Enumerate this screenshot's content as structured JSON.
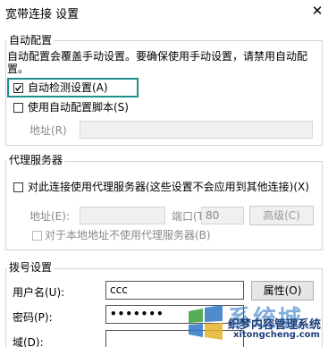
{
  "window": {
    "title": "宽带连接 设置",
    "close_glyph": "✕"
  },
  "auto_config": {
    "group_label": "自动配置",
    "desc_line1": "自动配置会覆盖手动设置。要确保使用手动设置，请禁用自动配",
    "desc_line2": "置。",
    "auto_detect_label": "自动检测设置(A)",
    "auto_detect_checked": true,
    "script_label": "使用自动配置脚本(S)",
    "script_checked": false,
    "address_label": "地址(R)",
    "address_value": ""
  },
  "proxy": {
    "group_label": "代理服务器",
    "use_proxy_label": "对此连接使用代理服务器(这些设置不会应用到其他连接)(X)",
    "use_proxy_checked": false,
    "address_label": "地址(E):",
    "address_value": "",
    "port_label": "端口(T):",
    "port_value": "80",
    "advanced_label": "高级(C)",
    "bypass_label": "对于本地地址不使用代理服务器(B)",
    "bypass_checked": false
  },
  "dialup": {
    "group_label": "拨号设置",
    "username_label": "用户名(U):",
    "username_value": "ccc",
    "properties_label": "属性(O)",
    "password_label": "密码(P):",
    "password_value": "•••••••",
    "domain_label": "域(D):",
    "domain_value": ""
  },
  "watermark": {
    "brand": "系统城",
    "line1": "织梦内容管理系统",
    "line2": "xitongcheng.com"
  },
  "colors": {
    "focus_border": "#1b8e8e",
    "group_border": "#d4d4d4",
    "watermark_blue": "#1f6dbf"
  }
}
